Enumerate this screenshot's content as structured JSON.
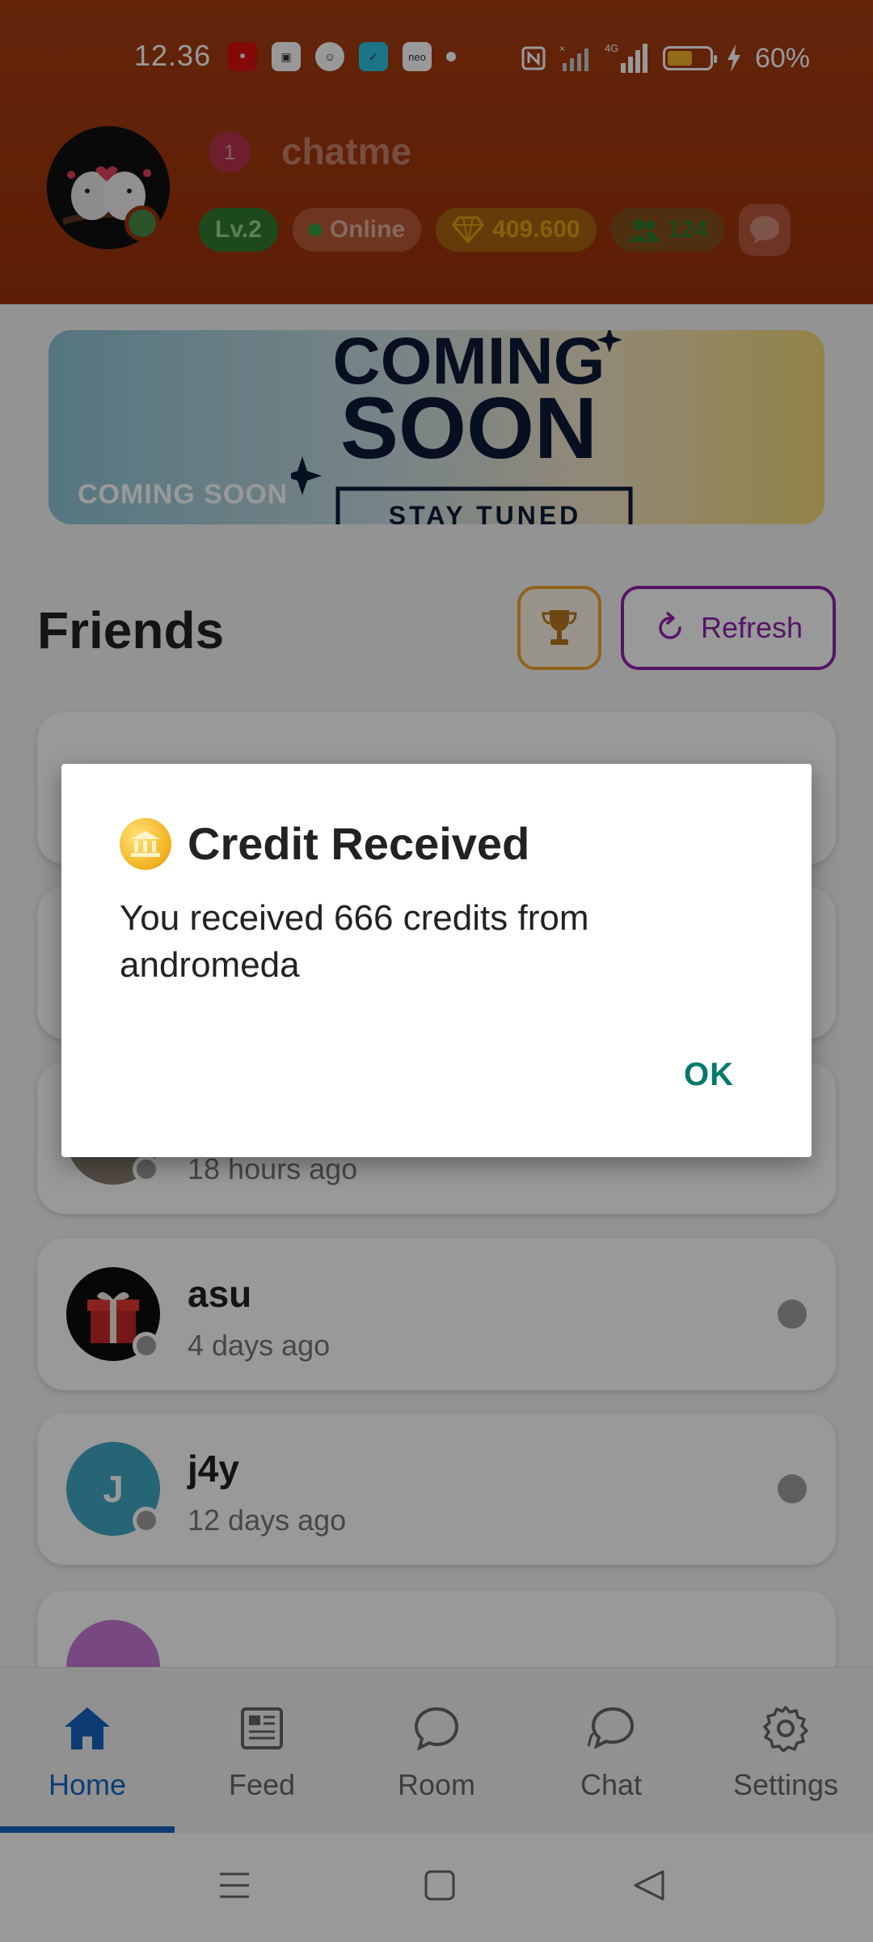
{
  "status_bar": {
    "time": "12.36",
    "battery_percent": "60%",
    "battery_level": 0.6,
    "network": "4G",
    "icons": [
      "line-app-icon",
      "wallet-icon",
      "chat-bubble-icon",
      "cart-icon",
      "neo-app-icon",
      "dot-icon",
      "nfc-icon",
      "signal-x-icon",
      "signal-icon",
      "battery-icon",
      "charging-icon"
    ]
  },
  "profile": {
    "notification_count": "1",
    "username": "chatme",
    "level": "Lv.2",
    "status": "Online",
    "credits": "409.600",
    "friends_count": "124"
  },
  "banner": {
    "caption": "COMING SOON",
    "art_line1": "COMING",
    "art_line2": "SOON",
    "art_line3": "STAY TUNED"
  },
  "friends": {
    "title": "Friends",
    "refresh_label": "Refresh",
    "items": [
      {
        "name": "",
        "last_seen": "18 hours ago",
        "avatar_letter": ""
      },
      {
        "name": "asu",
        "last_seen": "4 days ago",
        "avatar_letter": ""
      },
      {
        "name": "j4y",
        "last_seen": "12 days ago",
        "avatar_letter": "J"
      }
    ]
  },
  "nav": {
    "items": [
      {
        "label": "Home",
        "icon": "home-icon",
        "active": true
      },
      {
        "label": "Feed",
        "icon": "feed-icon",
        "active": false
      },
      {
        "label": "Room",
        "icon": "room-icon",
        "active": false
      },
      {
        "label": "Chat",
        "icon": "chat-icon",
        "active": false
      },
      {
        "label": "Settings",
        "icon": "settings-icon",
        "active": false
      }
    ]
  },
  "dialog": {
    "title": "Credit Received",
    "message": "You received 666 credits from andromeda",
    "ok_label": "OK"
  },
  "colors": {
    "header": "#9b3309",
    "accent_nav": "#1565c0",
    "refresh": "#8e24aa",
    "trophy": "#f0a530",
    "dialog_ok": "#00796b"
  }
}
